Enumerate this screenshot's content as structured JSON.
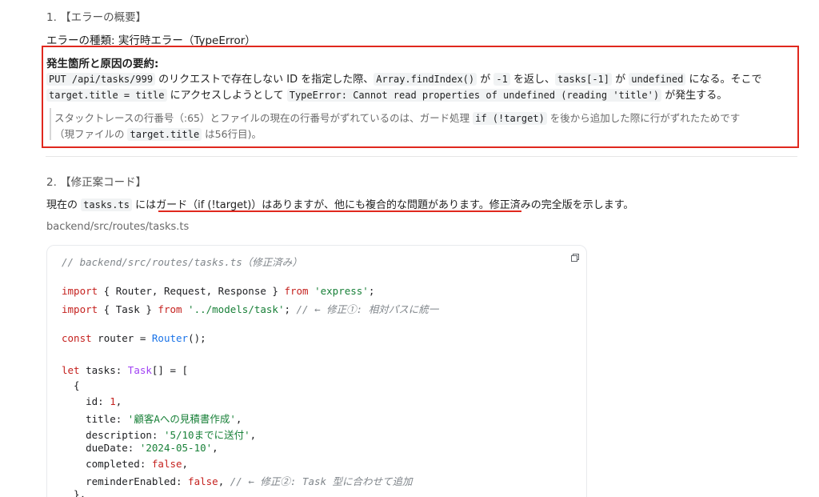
{
  "section1": {
    "heading": "1. 【エラーの概要】",
    "error_type_label": "エラーの種類: 実行時エラー（TypeError）",
    "summary_title": "発生箇所と原因の要約:",
    "line1": {
      "code1": "PUT /api/tasks/999",
      "t1": " のリクエストで存在しない ID を指定した際、",
      "code2": "Array.findIndex()",
      "t2": " が ",
      "code3": "-1",
      "t3": " を返し、",
      "code4": "tasks[-1]",
      "t4": " が ",
      "code5": "undefined",
      "t5": " になる。そこで"
    },
    "line2": {
      "code1": "target.title = title",
      "t1": " にアクセスしようとして ",
      "code2": "TypeError: Cannot read properties of undefined (reading 'title')",
      "t2": " が発生する。"
    },
    "note1": {
      "t1": "スタックトレースの行番号（:65）とファイルの現在の行番号がずれているのは、ガード処理 ",
      "code1": "if (!target)",
      "t2": " を後から追加した際に行がずれたためです"
    },
    "note2": {
      "t1": "（現ファイルの ",
      "code1": "target.title",
      "t2": " は56行目)。"
    }
  },
  "section2": {
    "heading": "2. 【修正案コード】",
    "intro": {
      "t1": "現在の ",
      "code1": "tasks.ts",
      "t2": " には",
      "underlined": "ガード（if (!target)）はありますが、他にも複合的な問題があります。",
      "t3": "修正済みの完全版を示します。"
    },
    "file_path": "backend/src/routes/tasks.ts"
  },
  "code": {
    "l1": "// backend/src/routes/tasks.ts（修正済み）",
    "l2_kw": "import",
    "l2_rest": " { Router, Request, Response } ",
    "l2_from": "from",
    "l2_str": " 'express'",
    "l2_end": ";",
    "l3_kw": "import",
    "l3_rest": " { Task } ",
    "l3_from": "from",
    "l3_str": " '../models/task'",
    "l3_end": "; ",
    "l3_cm": "// ← 修正①: 相対パスに統一",
    "l4_kw": "const",
    "l4_rest": " router = ",
    "l4_fn": "Router",
    "l4_end": "();",
    "l5_kw": "let",
    "l5_rest": " tasks: ",
    "l5_ty": "Task",
    "l5_end": "[] = [",
    "l6": "  {",
    "l7_key": "    id: ",
    "l7_num": "1",
    "l7_end": ",",
    "l8_key": "    title: ",
    "l8_str": "'顧客Aへの見積書作成'",
    "l8_end": ",",
    "l9_key": "    description: ",
    "l9_str": "'5/10までに送付'",
    "l9_end": ",",
    "l10_key": "    dueDate: ",
    "l10_str": "'2024-05-10'",
    "l10_end": ",",
    "l11_key": "    completed: ",
    "l11_kw": "false",
    "l11_end": ",",
    "l12_key": "    reminderEnabled: ",
    "l12_kw": "false",
    "l12_end": ", ",
    "l12_cm": "// ← 修正②: Task 型に合わせて追加",
    "l13": "  },"
  },
  "icons": {
    "copy": "copy-icon"
  },
  "colors": {
    "highlight": "#e0281e"
  }
}
